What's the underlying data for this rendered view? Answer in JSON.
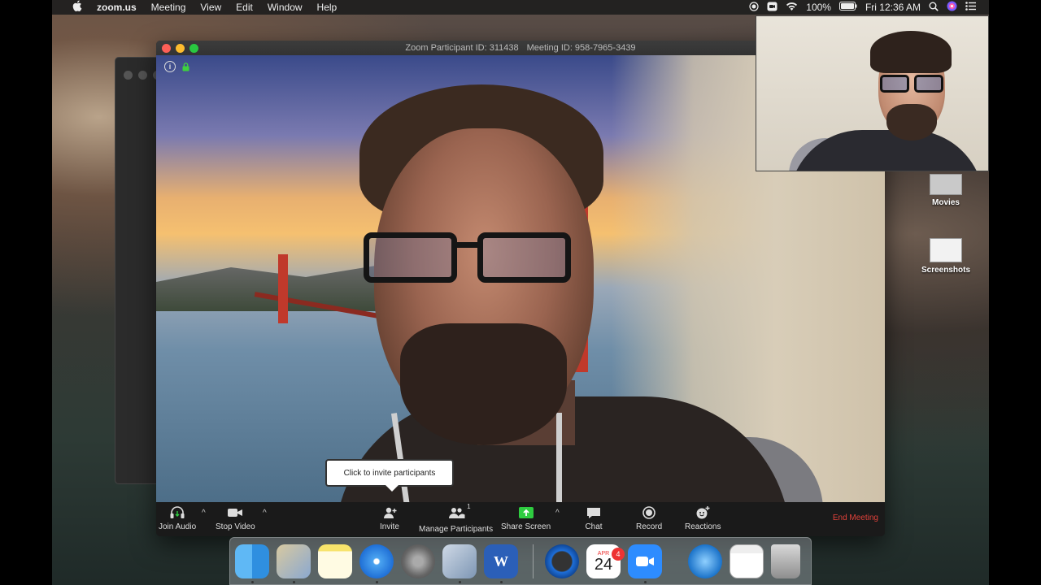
{
  "menubar": {
    "app_name": "zoom.us",
    "items": [
      "Meeting",
      "View",
      "Edit",
      "Window",
      "Help"
    ],
    "battery": "100%",
    "datetime": "Fri 12:36 AM"
  },
  "zoom_window": {
    "title_participant": "Zoom Participant ID: 311438",
    "title_meeting": "Meeting ID: 958-7965-3439",
    "tooltip": "Click to invite participants",
    "toolbar": {
      "join_audio": "Join Audio",
      "stop_video": "Stop Video",
      "invite": "Invite",
      "manage_participants": "Manage Participants",
      "participants_count": "1",
      "share_screen": "Share Screen",
      "chat": "Chat",
      "record": "Record",
      "reactions": "Reactions",
      "end_meeting": "End Meeting"
    },
    "info_icon": "i"
  },
  "desktop_icons": [
    {
      "label": "Movies"
    },
    {
      "label": "Screenshots"
    }
  ],
  "dock": {
    "calendar_month": "APR",
    "calendar_day": "24",
    "calendar_badge": "4",
    "apps": [
      "finder-icon",
      "mail-icon",
      "notes-icon",
      "safari-icon",
      "system-preferences-icon",
      "preview-icon",
      "word-icon",
      "quicktime-icon",
      "calendar-icon",
      "zoom-icon",
      "globe-icon",
      "browser-window-icon",
      "trash-icon"
    ]
  },
  "colors": {
    "end_meeting": "#e0413a",
    "share_screen": "#2ecc40",
    "zoom_blue": "#2d8cff"
  }
}
